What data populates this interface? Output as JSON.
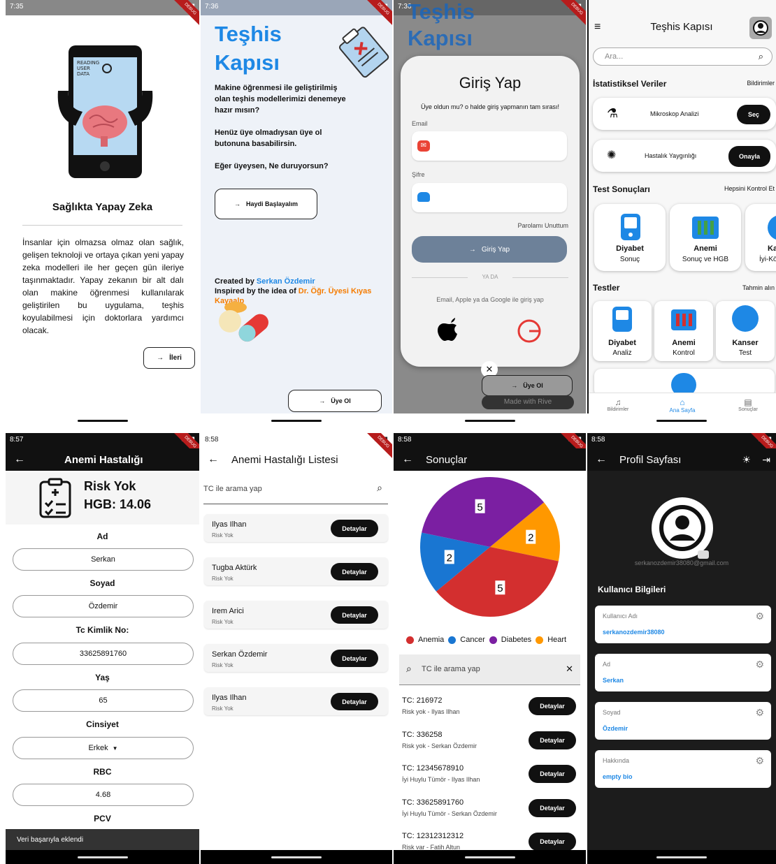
{
  "screen1": {
    "time": "7:35",
    "illus_words": [
      "READING",
      "USER",
      "DATA"
    ],
    "title": "Sağlıkta Yapay Zeka",
    "body": "İnsanlar için olmazsa olmaz olan sağlık, gelişen teknoloji ve ortaya çıkan yeni yapay zeka modelleri ile her geçen gün ileriye taşınmaktadır. Yapay zekanın bir alt dalı olan makine öğrenmesi kullanılarak geliştirilen bu uygulama, teşhis koyulabilmesi için doktorlara yardımcı olacak.",
    "next": "İleri"
  },
  "screen2": {
    "time": "7:36",
    "title": "Teşhis Kapısı",
    "p1": "Makine öğrenmesi ile geliştirilmiş olan teşhis modellerimizi denemeye hazır mısın?",
    "p2": "Henüz üye olmadıysan üye ol butonuna basabilirsin.",
    "p3": "Eğer üyeysen, Ne duruyorsun?",
    "start": "Haydi Başlayalım",
    "created_prefix": "Created by ",
    "creator": "Serkan Özdemir",
    "inspired_prefix": "Inspired by the idea of ",
    "inspirer": "Dr. Öğr. Üyesi Kıyas Kayaalp",
    "signup": "Üye Ol"
  },
  "screen3": {
    "time": "7:36",
    "bg_title": "Teşhis Kapısı",
    "title": "Giriş Yap",
    "subtitle": "Üye oldun mu? o halde giriş yapmanın tam sırası!",
    "email_label": "Email",
    "password_label": "Şifre",
    "forgot": "Parolamı Unuttum",
    "login": "Giriş Yap",
    "or": "YA DA",
    "social": "Email, Apple ya da Google ile giriş yap",
    "close": "✕",
    "signup": "Üye Ol",
    "rive": "Made with Rive"
  },
  "screen4": {
    "title": "Teşhis Kapısı",
    "search": "Ara...",
    "stats_title": "İstatistiksel Veriler",
    "stats_link": "Bildirimler",
    "row1_label": "Mikroskop Analizi",
    "row1_btn": "Seç",
    "row2_label": "Hastalık Yaygınlığı",
    "row2_btn": "Onayla",
    "results_title": "Test Sonuçları",
    "results_link": "Hepsini Kontrol Et",
    "results": [
      {
        "t": "Diyabet",
        "s": "Sonuç"
      },
      {
        "t": "Anemi",
        "s": "Sonuç ve HGB"
      },
      {
        "t": "Ka",
        "s": "İyi-Kö"
      }
    ],
    "tests_title": "Testler",
    "tests_link": "Tahmin alın",
    "tests": [
      {
        "t": "Diyabet",
        "s": "Analiz"
      },
      {
        "t": "Anemi",
        "s": "Kontrol"
      },
      {
        "t": "Kanser",
        "s": "Test"
      }
    ],
    "nav": [
      "Bildirimler",
      "Ana Sayfa",
      "Sonuçlar"
    ]
  },
  "screen5": {
    "time": "8:57",
    "title": "Anemi Hastalığı",
    "risk": "Risk Yok",
    "hgb": "HGB: 14.06",
    "fields": [
      {
        "label": "Ad",
        "value": "Serkan"
      },
      {
        "label": "Soyad",
        "value": "Özdemir"
      },
      {
        "label": "Tc Kimlik No:",
        "value": "33625891760"
      },
      {
        "label": "Yaş",
        "value": "65"
      },
      {
        "label": "Cinsiyet",
        "value": "Erkek"
      },
      {
        "label": "RBC",
        "value": "4.68"
      }
    ],
    "last_label": "PCV",
    "snackbar": "Veri başarıyla eklendi"
  },
  "screen6": {
    "time": "8:58",
    "title": "Anemi Hastalığı Listesi",
    "search": "TC ile arama yap",
    "btn": "Detaylar",
    "items": [
      {
        "name": "Ilyas Ilhan",
        "status": "Risk Yok"
      },
      {
        "name": "Tugba Aktürk",
        "status": "Risk Yok"
      },
      {
        "name": "Irem Arici",
        "status": "Risk Yok"
      },
      {
        "name": "Serkan Özdemir",
        "status": "Risk Yok"
      },
      {
        "name": "Ilyas Ilhan",
        "status": "Risk Yok"
      }
    ]
  },
  "screen7": {
    "time": "8:58",
    "title": "Sonuçlar",
    "search": "TC ile arama yap",
    "btn": "Detaylar",
    "items": [
      {
        "tc": "TC: 216972",
        "sub": "Risk yok - Ilyas Ilhan"
      },
      {
        "tc": "TC: 336258",
        "sub": "Risk yok - Serkan Özdemir"
      },
      {
        "tc": "TC: 12345678910",
        "sub": "İyi Huylu Tümör - Ilyas Ilhan"
      },
      {
        "tc": "TC: 33625891760",
        "sub": "İyi Huylu Tümör - Serkan Özdemir"
      },
      {
        "tc": "TC: 12312312312",
        "sub": "Risk var - Fatih Altun"
      }
    ]
  },
  "screen8": {
    "time": "8:58",
    "title": "Profil Sayfası",
    "email": "serkanozdemir38080@gmail.com",
    "section": "Kullanıcı Bilgileri",
    "cards": [
      {
        "label": "Kullanıcı Adı",
        "value": "serkanozdemir38080"
      },
      {
        "label": "Ad",
        "value": "Serkan"
      },
      {
        "label": "Soyad",
        "value": "Özdemir"
      },
      {
        "label": "Hakkında",
        "value": "empty bio"
      }
    ]
  },
  "debug": "DEBUG",
  "chart_data": {
    "type": "pie",
    "categories": [
      "Anemia",
      "Cancer",
      "Diabetes",
      "Heart"
    ],
    "values": [
      5,
      2,
      5,
      2
    ],
    "colors": [
      "#d32f2f",
      "#1976d2",
      "#7b1fa2",
      "#ff9800"
    ]
  }
}
